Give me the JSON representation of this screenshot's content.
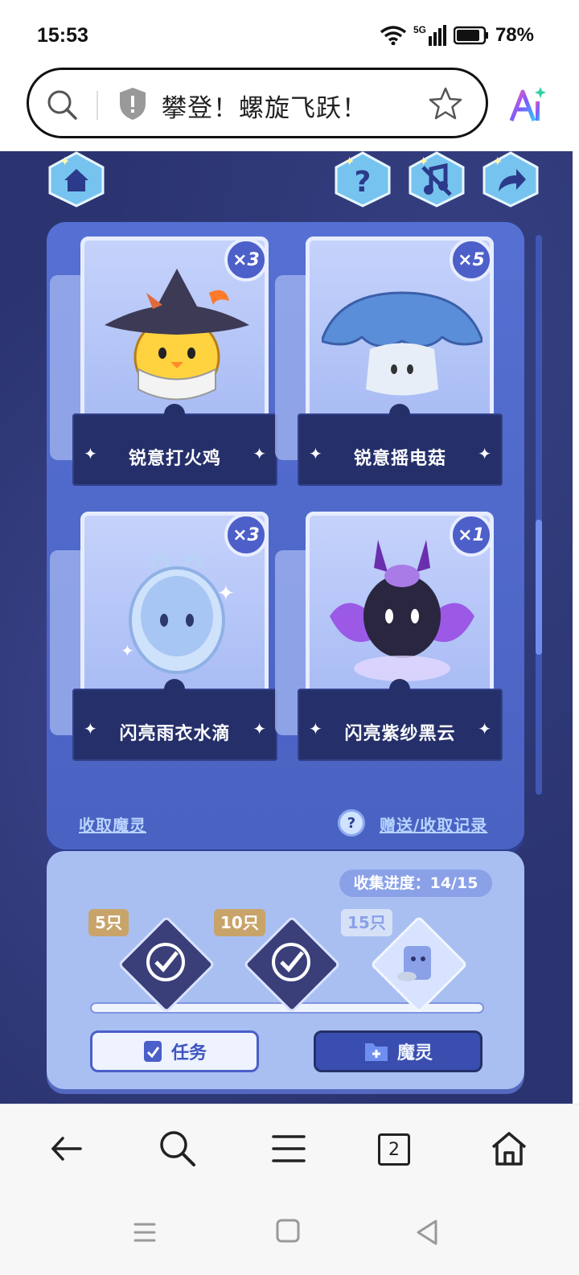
{
  "status_bar": {
    "time": "15:53",
    "network": "5G",
    "battery": "78%"
  },
  "url_bar": {
    "title": "攀登！螺旋飞跃！"
  },
  "game": {
    "top_icons": [
      "home-icon",
      "help-icon",
      "music-off-icon",
      "share-icon"
    ],
    "cards": [
      {
        "name": "锐意打火鸡",
        "count": "×3"
      },
      {
        "name": "锐意摇电菇",
        "count": "×5"
      },
      {
        "name": "闪亮雨衣水滴",
        "count": "×3"
      },
      {
        "name": "闪亮紫纱黑云",
        "count": "×1"
      }
    ],
    "receive_link": "收取魔灵",
    "record_link": "赠送/收取记录",
    "help_mark": "?",
    "progress_label": "收集进度：",
    "progress_value": "14/15",
    "milestones": [
      {
        "label": "5只",
        "claimed": true
      },
      {
        "label": "10只",
        "claimed": true
      },
      {
        "label": "15只",
        "claimed": false
      }
    ],
    "buttons": {
      "task": "任务",
      "sprite": "魔灵"
    },
    "colors": {
      "background": "#2b3470",
      "panel": "#4a62c2",
      "card_label": "#25306a"
    }
  },
  "bottom_nav": {
    "tab_count": "2"
  }
}
